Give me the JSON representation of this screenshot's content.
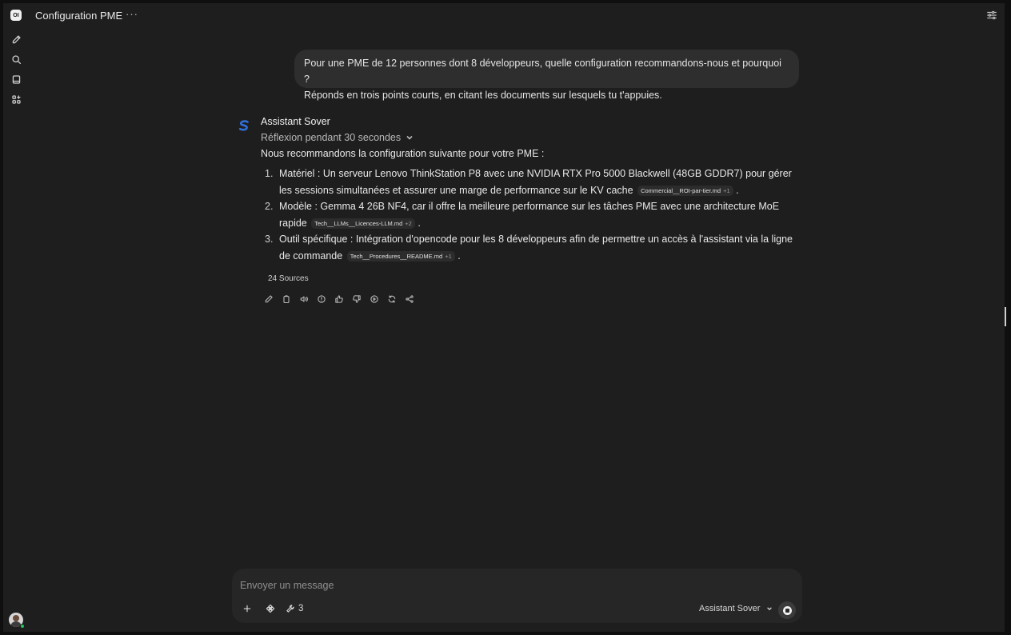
{
  "app": {
    "title": "Configuration PME",
    "logo_text": "OI"
  },
  "user_message": {
    "line1": "Pour une PME de 12 personnes dont 8 développeurs, quelle configuration recommandons-nous et pourquoi ?",
    "line2": "Réponds en trois points courts, en citant les documents sur lesquels tu t'appuies."
  },
  "assistant": {
    "name": "Assistant Sover",
    "reflection": "Réflexion pendant 30 secondes",
    "intro": "Nous recommandons la configuration suivante pour votre PME :",
    "items": [
      {
        "num": "1.",
        "text": "Matériel : Un serveur Lenovo ThinkStation P8 avec une NVIDIA RTX Pro 5000 Blackwell (48GB GDDR7) pour gérer les sessions simultanées et assurer une marge de performance sur le KV cache",
        "chip": "Commercial__ROI-par-tier.md",
        "chip_extra": "+1"
      },
      {
        "num": "2.",
        "text": "Modèle : Gemma 4 26B NF4, car il offre la meilleure performance sur les tâches PME avec une architecture MoE rapide",
        "chip": "Tech__LLMs__Licences-LLM.md",
        "chip_extra": "+2"
      },
      {
        "num": "3.",
        "text": "Outil spécifique : Intégration d'opencode pour les 8 développeurs afin de permettre un accès à l'assistant via la ligne de commande",
        "chip": "Tech__Procedures__README.md",
        "chip_extra": "+1"
      }
    ],
    "sources": "24 Sources",
    "accent_color": "#2f6fd8"
  },
  "composer": {
    "placeholder": "Envoyer un message",
    "tools_count": "3",
    "model": "Assistant Sover"
  },
  "icons": {
    "rail": [
      "new-chat-icon",
      "search-icon",
      "notes-icon",
      "workspace-icon"
    ],
    "actions": [
      "edit-icon",
      "copy-icon",
      "read-aloud-icon",
      "info-icon",
      "thumbs-up-icon",
      "thumbs-down-icon",
      "continue-icon",
      "regenerate-icon",
      "share-icon"
    ]
  }
}
